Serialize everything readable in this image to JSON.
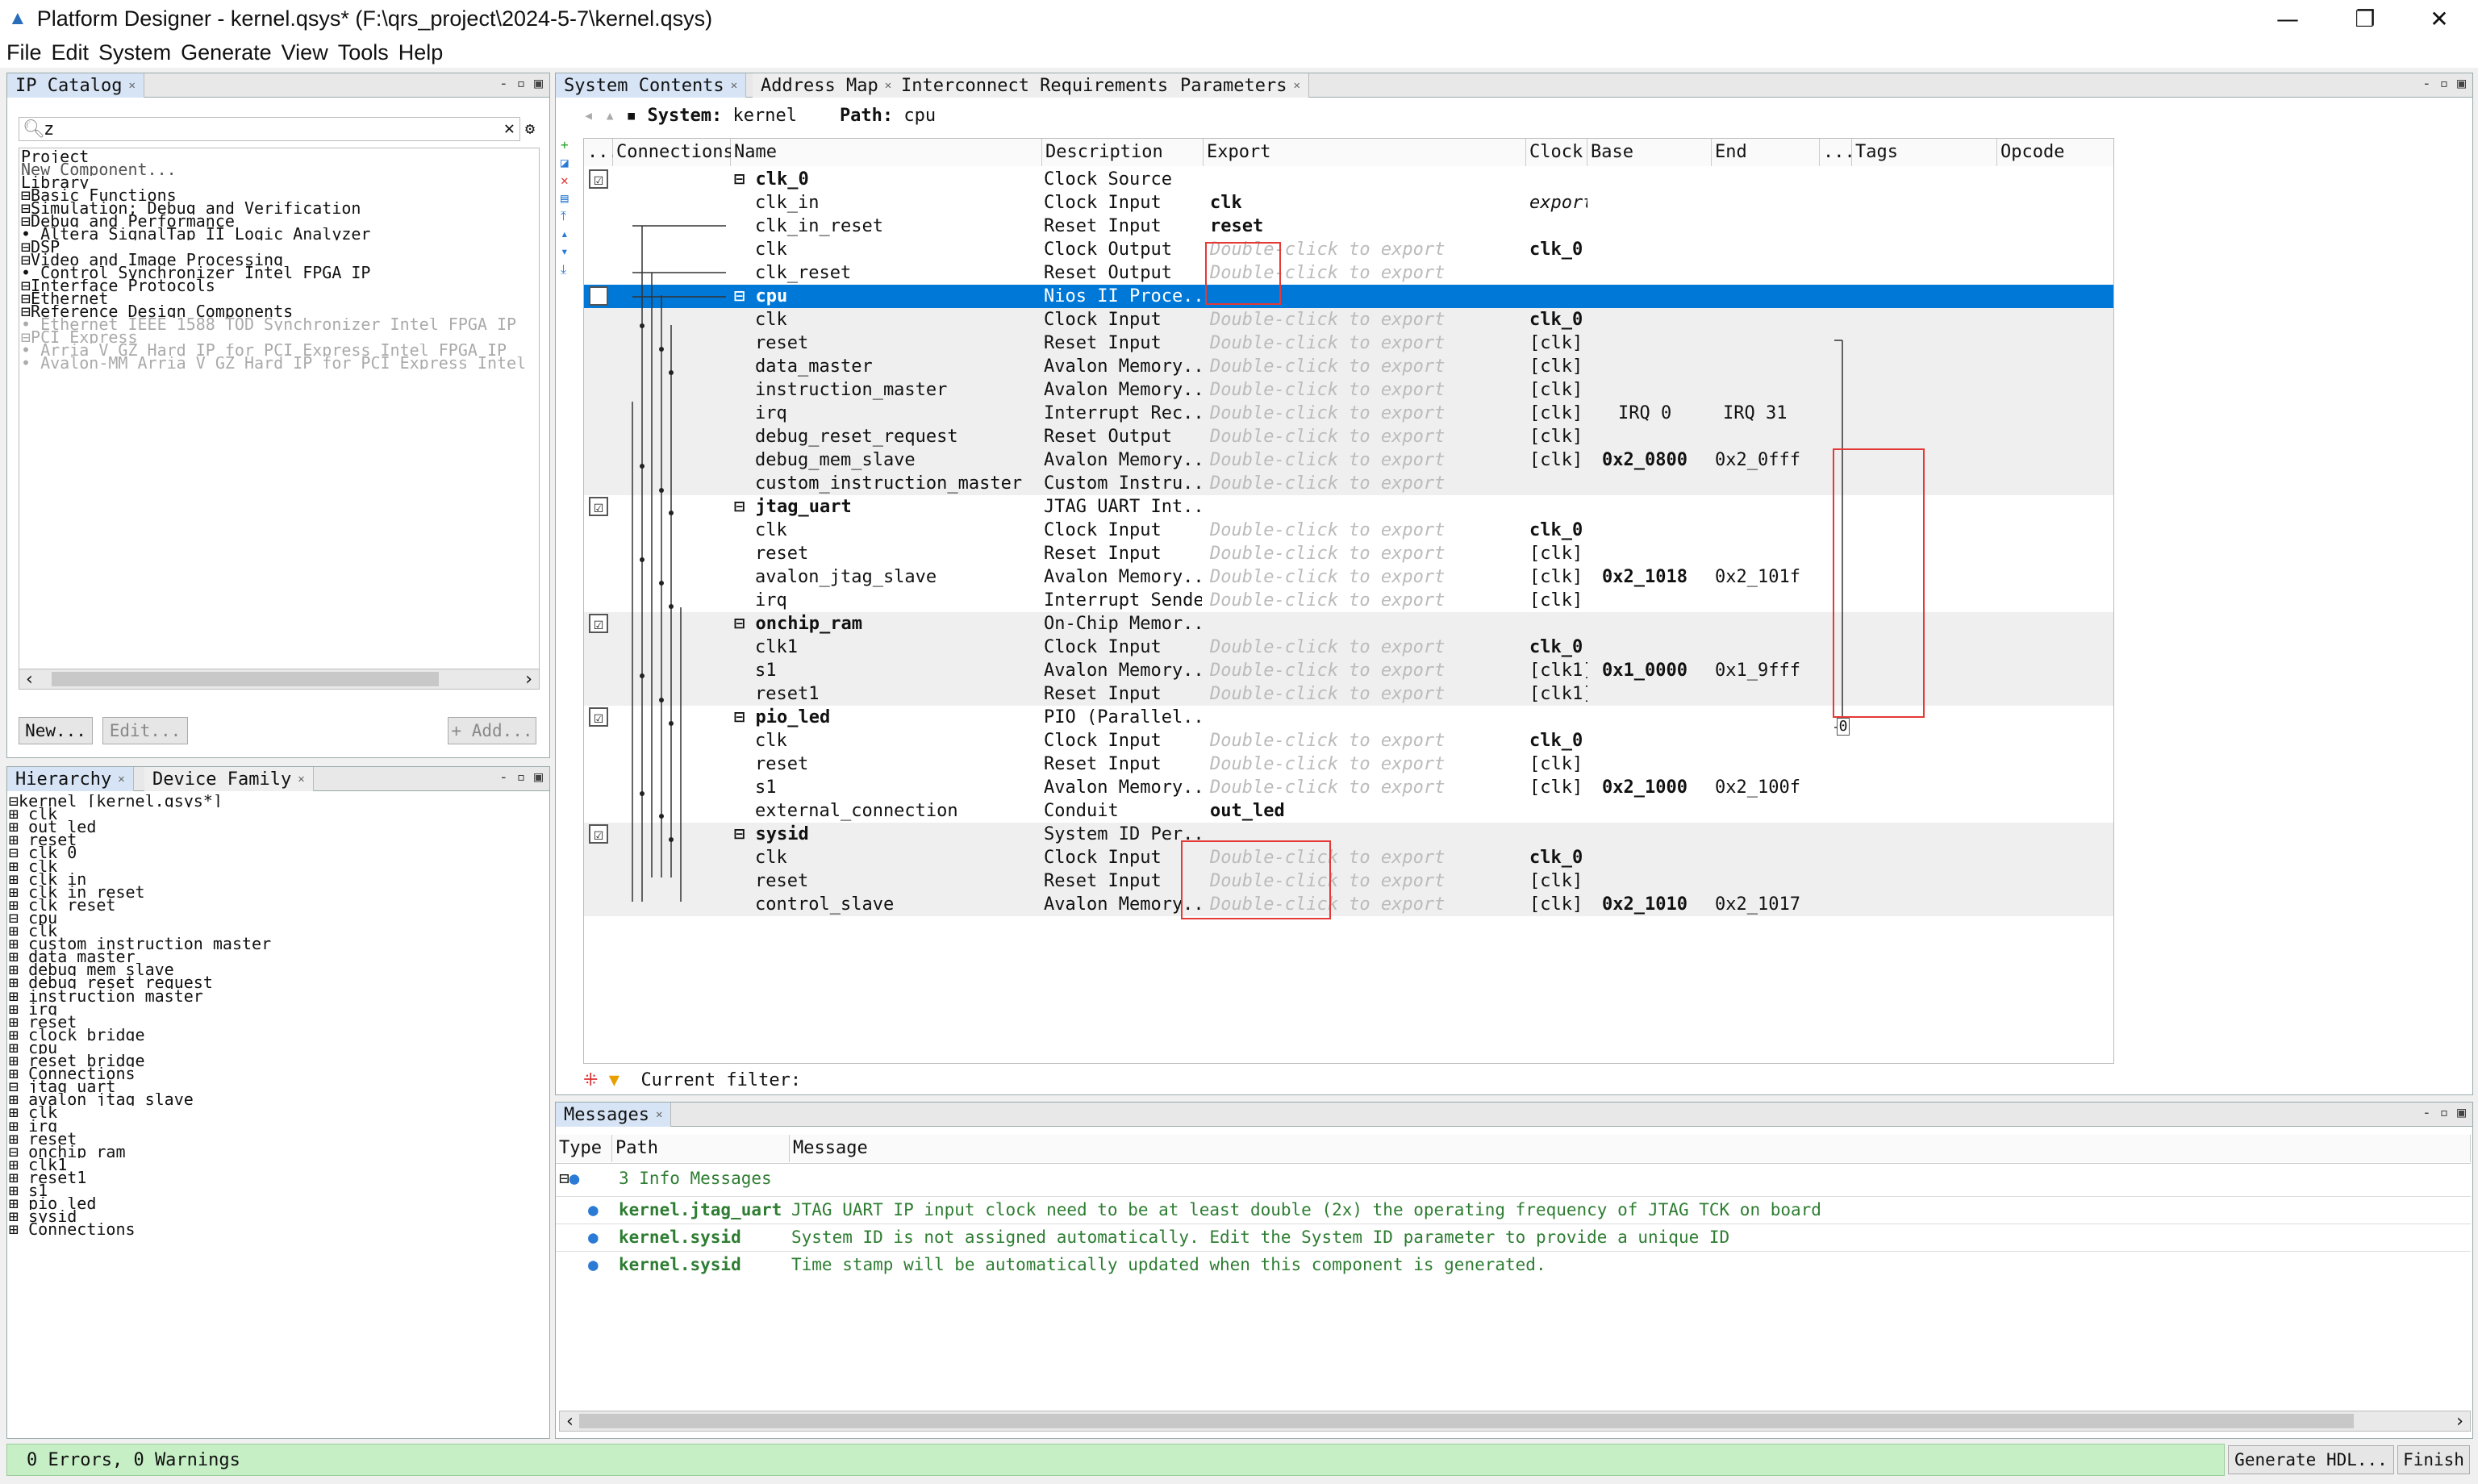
{
  "title": "Platform Designer - kernel.qsys* (F:\\qrs_project\\2024-5-7\\kernel.qsys)",
  "menu": [
    "File",
    "Edit",
    "System",
    "Generate",
    "View",
    "Tools",
    "Help"
  ],
  "ip_catalog": {
    "tab": "IP Catalog",
    "search_value": "z",
    "tree": [
      "Project",
      "    New Component...",
      "Library",
      "⊟Basic Functions",
      "  ⊟Simulation; Debug and Verification",
      "    ⊟Debug and Performance",
      "       • Altera SignalTap II Logic Analyzer",
      "⊟DSP",
      "  ⊟Video and Image Processing",
      "      • Control Synchronizer Intel FPGA IP",
      "⊟Interface Protocols",
      "  ⊟Ethernet",
      "    ⊟Reference Design Components",
      "       • Ethernet IEEE 1588 TOD Synchronizer Intel FPGA IP",
      "  ⊟PCI Express",
      "     • Arria V GZ Hard IP for PCI Express Intel FPGA IP",
      "     • Avalon-MM Arria V GZ Hard IP for PCI Express Intel FPGA IP"
    ],
    "buttons": {
      "new": "New...",
      "edit": "Edit...",
      "add": "+ Add..."
    }
  },
  "hierarchy": {
    "tabs": [
      "Hierarchy",
      "Device Family"
    ],
    "tree": [
      "⊟kernel [kernel.qsys*]",
      "  ⊞ clk",
      "  ⊞ out_led",
      "  ⊞ reset",
      "  ⊟ clk_0",
      "    ⊞ clk",
      "    ⊞ clk_in",
      "    ⊞ clk_in_reset",
      "    ⊞ clk_reset",
      "  ⊟ cpu",
      "    ⊞ clk",
      "    ⊞ custom_instruction_master",
      "    ⊞ data_master",
      "    ⊞ debug_mem_slave",
      "    ⊞ debug_reset_request",
      "    ⊞ instruction_master",
      "    ⊞ irq",
      "    ⊞ reset",
      "    ⊞ clock_bridge",
      "    ⊞ cpu",
      "    ⊞ reset_bridge",
      "    ⊞ Connections",
      "  ⊟ jtag_uart",
      "    ⊞ avalon_jtag_slave",
      "    ⊞ clk",
      "    ⊞ irq",
      "    ⊞ reset",
      "  ⊟ onchip_ram",
      "    ⊞ clk1",
      "    ⊞ reset1",
      "    ⊞ s1",
      "  ⊞ pio_led",
      "  ⊞ sysid",
      "  ⊞ Connections"
    ]
  },
  "system": {
    "tabs": [
      "System Contents",
      "Address Map",
      "Interconnect Requirements",
      "Parameters"
    ],
    "system_label": "System:",
    "system_name": "kernel",
    "path_label": "Path:",
    "path_value": "cpu",
    "columns": [
      "...",
      "Connections",
      "Name",
      "Description",
      "Export",
      "Clock",
      "Base",
      "End",
      "...",
      "Tags",
      "Opcode Name"
    ],
    "rows": [
      {
        "use": "☑",
        "name": "⊟ clk_0",
        "desc": "Clock Source",
        "export": "",
        "clock": "",
        "base": "",
        "end": "",
        "bold": true
      },
      {
        "use": "",
        "name": "clk_in",
        "desc": "Clock Input",
        "export": "clk",
        "clock": "exported",
        "base": "",
        "end": ""
      },
      {
        "use": "",
        "name": "clk_in_reset",
        "desc": "Reset Input",
        "export": "reset",
        "clock": "",
        "base": "",
        "end": ""
      },
      {
        "use": "",
        "name": "clk",
        "desc": "Clock Output",
        "export": "Double-click to export",
        "clock": "clk_0",
        "base": "",
        "end": ""
      },
      {
        "use": "",
        "name": "clk_reset",
        "desc": "Reset Output",
        "export": "Double-click to export",
        "clock": "",
        "base": "",
        "end": ""
      },
      {
        "use": "☑",
        "name": "⊟ cpu",
        "desc": "Nios II Proce...",
        "export": "",
        "clock": "",
        "base": "",
        "end": "",
        "bold": true,
        "selected": true
      },
      {
        "use": "",
        "name": "clk",
        "desc": "Clock Input",
        "export": "Double-click to export",
        "clock": "clk_0",
        "base": "",
        "end": ""
      },
      {
        "use": "",
        "name": "reset",
        "desc": "Reset Input",
        "export": "Double-click to export",
        "clock": "[clk]",
        "base": "",
        "end": ""
      },
      {
        "use": "",
        "name": "data_master",
        "desc": "Avalon Memory...",
        "export": "Double-click to export",
        "clock": "[clk]",
        "base": "",
        "end": ""
      },
      {
        "use": "",
        "name": "instruction_master",
        "desc": "Avalon Memory...",
        "export": "Double-click to export",
        "clock": "[clk]",
        "base": "",
        "end": ""
      },
      {
        "use": "",
        "name": "irq",
        "desc": "Interrupt Rec...",
        "export": "Double-click to export",
        "clock": "[clk]",
        "base": "IRQ 0",
        "end": "IRQ 31"
      },
      {
        "use": "",
        "name": "debug_reset_request",
        "desc": "Reset Output",
        "export": "Double-click to export",
        "clock": "[clk]",
        "base": "",
        "end": ""
      },
      {
        "use": "",
        "name": "debug_mem_slave",
        "desc": "Avalon Memory...",
        "export": "Double-click to export",
        "clock": "[clk]",
        "base": "0x2_0800",
        "end": "0x2_0fff"
      },
      {
        "use": "",
        "name": "custom_instruction_master",
        "desc": "Custom Instru...",
        "export": "Double-click to export",
        "clock": "",
        "base": "",
        "end": ""
      },
      {
        "use": "☑",
        "name": "⊟ jtag_uart",
        "desc": "JTAG UART Int...",
        "export": "",
        "clock": "",
        "base": "",
        "end": "",
        "bold": true
      },
      {
        "use": "",
        "name": "clk",
        "desc": "Clock Input",
        "export": "Double-click to export",
        "clock": "clk_0",
        "base": "",
        "end": ""
      },
      {
        "use": "",
        "name": "reset",
        "desc": "Reset Input",
        "export": "Double-click to export",
        "clock": "[clk]",
        "base": "",
        "end": ""
      },
      {
        "use": "",
        "name": "avalon_jtag_slave",
        "desc": "Avalon Memory...",
        "export": "Double-click to export",
        "clock": "[clk]",
        "base": "0x2_1018",
        "end": "0x2_101f"
      },
      {
        "use": "",
        "name": "irq",
        "desc": "Interrupt Sender",
        "export": "Double-click to export",
        "clock": "[clk]",
        "base": "",
        "end": ""
      },
      {
        "use": "☑",
        "name": "⊟ onchip_ram",
        "desc": "On-Chip Memor...",
        "export": "",
        "clock": "",
        "base": "",
        "end": "",
        "bold": true
      },
      {
        "use": "",
        "name": "clk1",
        "desc": "Clock Input",
        "export": "Double-click to export",
        "clock": "clk_0",
        "base": "",
        "end": ""
      },
      {
        "use": "",
        "name": "s1",
        "desc": "Avalon Memory...",
        "export": "Double-click to export",
        "clock": "[clk1]",
        "base": "0x1_0000",
        "end": "0x1_9fff"
      },
      {
        "use": "",
        "name": "reset1",
        "desc": "Reset Input",
        "export": "Double-click to export",
        "clock": "[clk1]",
        "base": "",
        "end": ""
      },
      {
        "use": "☑",
        "name": "⊟ pio_led",
        "desc": "PIO (Parallel...",
        "export": "",
        "clock": "",
        "base": "",
        "end": "",
        "bold": true
      },
      {
        "use": "",
        "name": "clk",
        "desc": "Clock Input",
        "export": "Double-click to export",
        "clock": "clk_0",
        "base": "",
        "end": ""
      },
      {
        "use": "",
        "name": "reset",
        "desc": "Reset Input",
        "export": "Double-click to export",
        "clock": "[clk]",
        "base": "",
        "end": ""
      },
      {
        "use": "",
        "name": "s1",
        "desc": "Avalon Memory...",
        "export": "Double-click to export",
        "clock": "[clk]",
        "base": "0x2_1000",
        "end": "0x2_100f"
      },
      {
        "use": "",
        "name": "external_connection",
        "desc": "Conduit",
        "export": "out_led",
        "clock": "",
        "base": "",
        "end": ""
      },
      {
        "use": "☑",
        "name": "⊟ sysid",
        "desc": "System ID Per...",
        "export": "",
        "clock": "",
        "base": "",
        "end": "",
        "bold": true
      },
      {
        "use": "",
        "name": "clk",
        "desc": "Clock Input",
        "export": "Double-click to export",
        "clock": "clk_0",
        "base": "",
        "end": ""
      },
      {
        "use": "",
        "name": "reset",
        "desc": "Reset Input",
        "export": "Double-click to export",
        "clock": "[clk]",
        "base": "",
        "end": ""
      },
      {
        "use": "",
        "name": "control_slave",
        "desc": "Avalon Memory...",
        "export": "Double-click to export",
        "clock": "[clk]",
        "base": "0x2_1010",
        "end": "0x2_1017"
      }
    ],
    "irq_value": "0",
    "filter_label": "Current filter:"
  },
  "messages": {
    "tab": "Messages",
    "columns": [
      "Type",
      "Path",
      "Message"
    ],
    "summary": "3 Info Messages",
    "items": [
      {
        "path": "kernel.jtag_uart",
        "text": "JTAG UART IP input clock need to be at least double (2x) the operating frequency of JTAG TCK on board"
      },
      {
        "path": "kernel.sysid",
        "text": "System ID is not assigned automatically. Edit the System ID parameter to provide a unique ID"
      },
      {
        "path": "kernel.sysid",
        "text": "Time stamp will be automatically updated when this component is generated."
      }
    ]
  },
  "status": {
    "text": "0 Errors, 0 Warnings",
    "generate": "Generate HDL...",
    "finish": "Finish"
  },
  "colors": {
    "selected": "#0078d7",
    "status_bg": "#c6efc6",
    "message_green": "#2e7d32",
    "highlight_box": "#e53935"
  }
}
